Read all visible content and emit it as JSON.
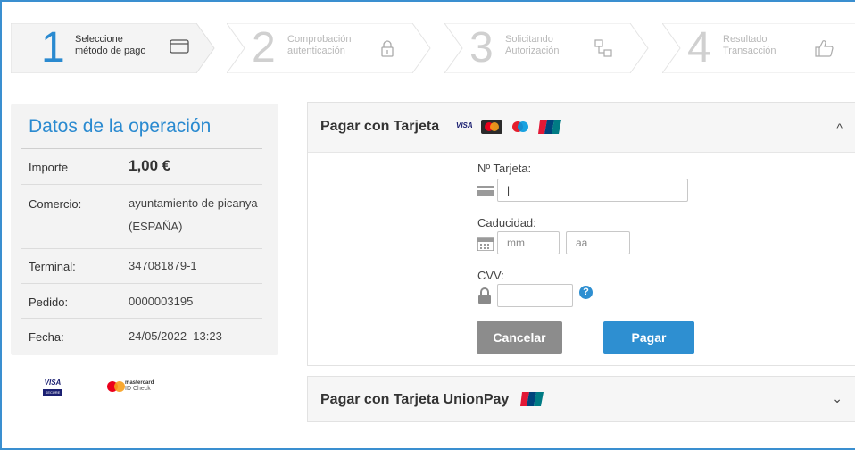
{
  "steps": [
    {
      "num": "1",
      "line1": "Seleccione",
      "line2": "método de pago",
      "icon": "card-icon",
      "state": "active"
    },
    {
      "num": "2",
      "line1": "Comprobación",
      "line2": "autenticación",
      "icon": "lock-icon",
      "state": "inactive"
    },
    {
      "num": "3",
      "line1": "Solicitando",
      "line2": "Autorización",
      "icon": "network-icon",
      "state": "inactive"
    },
    {
      "num": "4",
      "line1": "Resultado",
      "line2": "Transacción",
      "icon": "thumbs-up-icon",
      "state": "inactive"
    }
  ],
  "operation": {
    "title": "Datos de la operación",
    "rows": [
      {
        "label": "Importe",
        "value": "1,00 €"
      },
      {
        "label": "Comercio:",
        "value": "ayuntamiento de picanya",
        "value2": "(ESPAÑA)"
      },
      {
        "label": "Terminal:",
        "value": "347081879-1"
      },
      {
        "label": "Pedido:",
        "value": "0000003195"
      },
      {
        "label": "Fecha:",
        "value": "24/05/2022  13:23"
      }
    ]
  },
  "logos": {
    "visa_line1": "VISA",
    "visa_line2": "SECURE",
    "mc_line1": "mastercard",
    "mc_line2": "ID Check"
  },
  "card_payment": {
    "title": "Pagar con Tarjeta",
    "brand_visa": "VISA",
    "card_label": "Nº Tarjeta:",
    "card_value": "",
    "expiry_label": "Caducidad:",
    "month_placeholder": "mm",
    "year_placeholder": "aa",
    "cvv_label": "CVV:",
    "cvv_value": "",
    "help_symbol": "?",
    "cancel_label": "Cancelar",
    "pay_label": "Pagar",
    "chevron": "^"
  },
  "unionpay": {
    "title": "Pagar con Tarjeta UnionPay",
    "chevron": "⌄"
  },
  "colors": {
    "accent": "#2a8ad0",
    "pay_button": "#2e8fd1",
    "cancel_button": "#8c8c8c",
    "panel_bg": "#f3f3f3"
  }
}
